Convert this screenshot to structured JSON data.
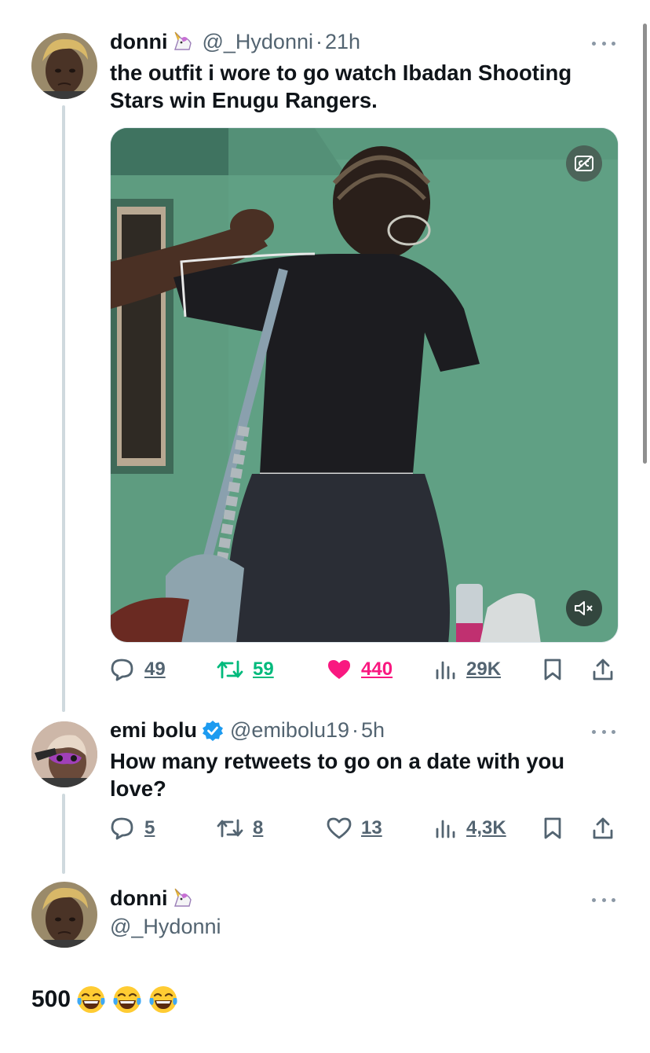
{
  "original_tweet": {
    "author_name": "donni",
    "author_handle": "@_Hydonni",
    "separator": "·",
    "time": "21h",
    "text": "the outfit i wore to go watch Ibadan Shooting Stars win Enugu Rangers.",
    "metrics": {
      "replies": "49",
      "retweets": "59",
      "likes": "440",
      "views": "29K"
    },
    "icons": [
      "more-icon",
      "cc-icon",
      "mute-icon",
      "reply-icon",
      "retweet-icon",
      "heart-filled-icon",
      "views-icon",
      "bookmark-icon",
      "share-icon"
    ]
  },
  "reply_tweet": {
    "author_name": "emi bolu",
    "author_handle": "@emibolu19",
    "separator": "·",
    "time": "5h",
    "verified": true,
    "text": "How many retweets to go on a date with you love?",
    "metrics": {
      "replies": "5",
      "retweets": "8",
      "likes": "13",
      "views": "4,3K"
    }
  },
  "answer_tweet": {
    "author_name": "donni",
    "author_handle": "@_Hydonni",
    "text": "500",
    "emoji_count": 3
  },
  "colors": {
    "text_primary": "#0f1419",
    "text_secondary": "#536471",
    "retweet_green": "#00ba7c",
    "like_pink": "#f91880",
    "verified_blue": "#1d9bf0",
    "thread_line": "#cfd9de"
  }
}
